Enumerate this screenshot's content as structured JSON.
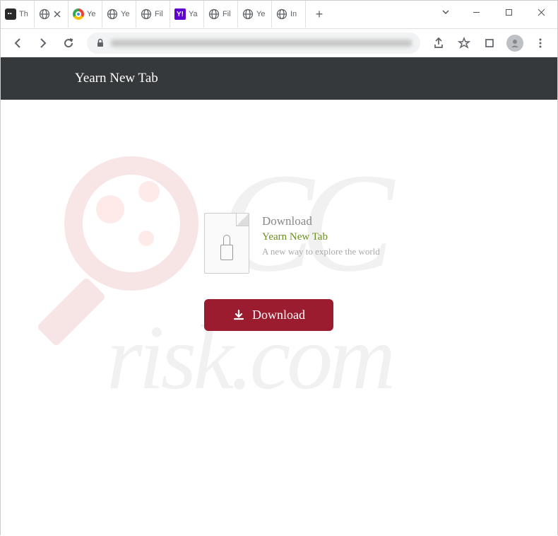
{
  "tabs": [
    {
      "title": "Th",
      "favicon": "dark"
    },
    {
      "title": "",
      "favicon": "globe",
      "active": true
    },
    {
      "title": "Ye",
      "favicon": "chrome"
    },
    {
      "title": "Ye",
      "favicon": "globe"
    },
    {
      "title": "Fil",
      "favicon": "globe"
    },
    {
      "title": "Ya",
      "favicon": "yahoo"
    },
    {
      "title": "Fil",
      "favicon": "globe"
    },
    {
      "title": "Ye",
      "favicon": "globe"
    },
    {
      "title": "In",
      "favicon": "globe"
    }
  ],
  "header": {
    "title": "Yearn New Tab"
  },
  "download": {
    "heading": "Download",
    "name": "Yearn New Tab",
    "description": "A new way to explore the world",
    "button": "Download"
  },
  "watermark": {
    "text1": "CC",
    "text2": "risk.com"
  },
  "yahoo_glyph": "Y!"
}
